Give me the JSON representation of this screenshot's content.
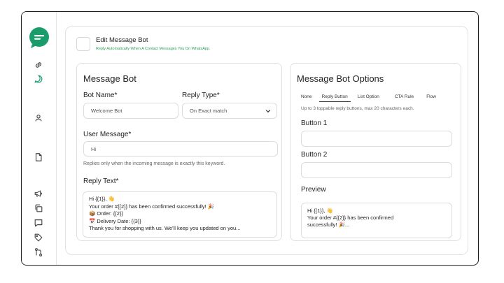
{
  "header": {
    "title": "Edit Message Bot",
    "subtitle": "Reply Automatically When A Contact Messages You On WhatsApp."
  },
  "left_panel": {
    "title": "Message Bot",
    "bot_name_label": "Bot Name*",
    "bot_name_value": "Welcome Bot",
    "reply_type_label": "Reply Type*",
    "reply_type_value": "On Exact match",
    "user_message_label": "User Message*",
    "user_message_value": "Hi",
    "user_message_helper": "Replies only when the incoming message is exactly this keyword.",
    "reply_text_label": "Reply Text*",
    "reply_text_lines": [
      "Hi {{1}}, 👋",
      "Your order #{{2}} has been confirmed successfully! 🎉",
      "📦 Order: {{2}}",
      "📅 Delivery Date: {{3}}",
      "Thank you for shopping with us. We'll keep you updated on you..."
    ]
  },
  "right_panel": {
    "title": "Message Bot Options",
    "tabs": [
      "None",
      "Reply Button",
      "List Option",
      "CTA Rule",
      "Flow"
    ],
    "active_tab": "Reply Button",
    "helper": "Up to 3 toppable reply buttons, max 20 characters each.",
    "button1_label": "Button 1",
    "button1_value": "",
    "button2_label": "Button 2",
    "button2_value": "",
    "preview_label": "Preview",
    "preview_lines": [
      "Hi {{1}}, 👋",
      "Your order #{{2}} has been confirmed",
      "successfully! 🎉..."
    ]
  },
  "sidebar": {
    "icons": [
      "link-icon",
      "chat-icon",
      "user-icon",
      "document-icon",
      "megaphone-icon",
      "copy-icon",
      "message-square-icon",
      "tag-icon",
      "git-flow-icon"
    ]
  },
  "colors": {
    "brand": "#1a9d6b",
    "subtitle": "#2a9d59",
    "active_nav": "#1a9d6b"
  }
}
